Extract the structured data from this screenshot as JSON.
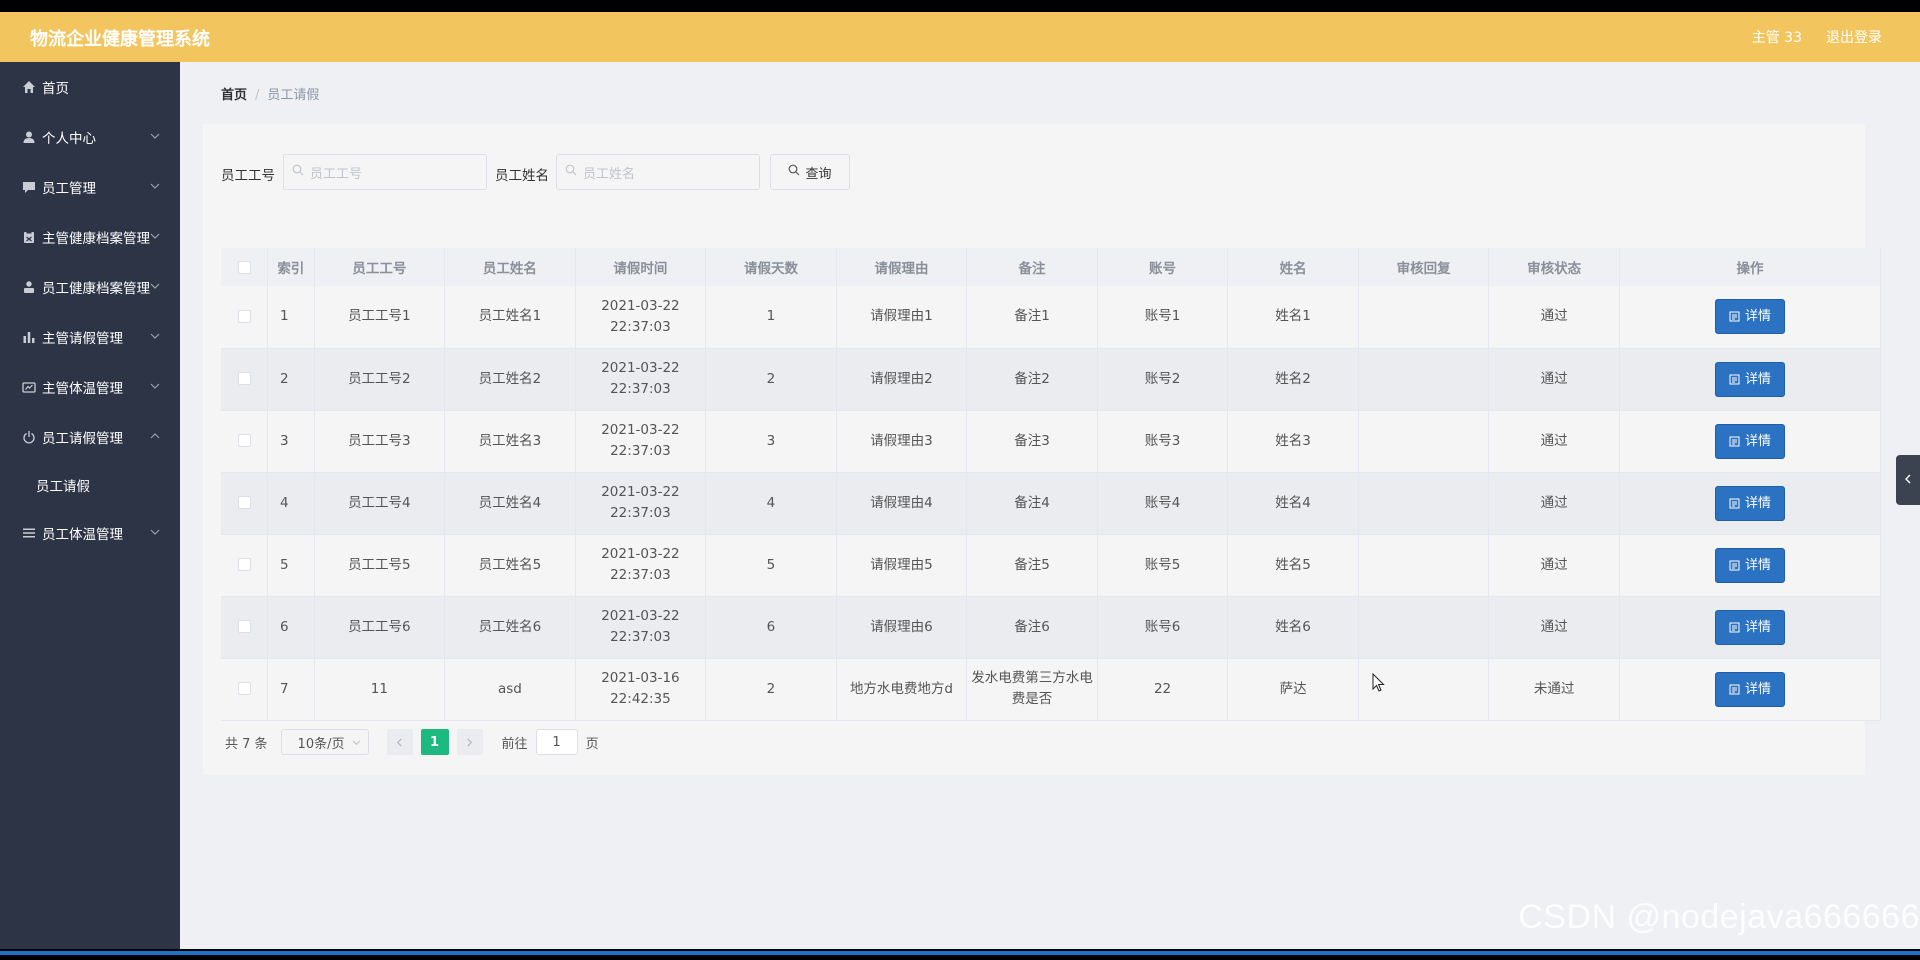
{
  "header": {
    "app_title": "物流企业健康管理系统",
    "user": "主管 33",
    "logout": "退出登录"
  },
  "sidebar": {
    "items": [
      {
        "label": "首页",
        "icon": "home-icon",
        "has_arrow": false
      },
      {
        "label": "个人中心",
        "icon": "user-icon",
        "has_arrow": true
      },
      {
        "label": "员工管理",
        "icon": "chat-icon",
        "has_arrow": true
      },
      {
        "label": "主管健康档案管理",
        "icon": "clipboard-icon",
        "has_arrow": true
      },
      {
        "label": "员工健康档案管理",
        "icon": "person-icon",
        "has_arrow": true
      },
      {
        "label": "主管请假管理",
        "icon": "bar-chart-icon",
        "has_arrow": true
      },
      {
        "label": "主管体温管理",
        "icon": "id-card-icon",
        "has_arrow": true
      },
      {
        "label": "员工请假管理",
        "icon": "power-icon",
        "has_arrow": true,
        "expanded": true,
        "children": [
          "员工请假"
        ]
      },
      {
        "label": "员工体温管理",
        "icon": "list-icon",
        "has_arrow": true
      }
    ]
  },
  "breadcrumb": {
    "home": "首页",
    "separator": "/",
    "current": "员工请假"
  },
  "search": {
    "emp_no_label": "员工工号",
    "emp_no_placeholder": "员工工号",
    "emp_name_label": "员工姓名",
    "emp_name_placeholder": "员工姓名",
    "button": "查询"
  },
  "table": {
    "headers": [
      "索引",
      "员工工号",
      "员工姓名",
      "请假时间",
      "请假天数",
      "请假理由",
      "备注",
      "账号",
      "姓名",
      "审核回复",
      "审核状态",
      "操作"
    ],
    "rows": [
      {
        "index": "1",
        "emp_no": "员工工号1",
        "emp_name": "员工姓名1",
        "time": "2021-03-22 22:37:03",
        "days": "1",
        "reason": "请假理由1",
        "note": "备注1",
        "account": "账号1",
        "name": "姓名1",
        "reply": "",
        "status": "通过",
        "action": "详情"
      },
      {
        "index": "2",
        "emp_no": "员工工号2",
        "emp_name": "员工姓名2",
        "time": "2021-03-22 22:37:03",
        "days": "2",
        "reason": "请假理由2",
        "note": "备注2",
        "account": "账号2",
        "name": "姓名2",
        "reply": "",
        "status": "通过",
        "action": "详情"
      },
      {
        "index": "3",
        "emp_no": "员工工号3",
        "emp_name": "员工姓名3",
        "time": "2021-03-22 22:37:03",
        "days": "3",
        "reason": "请假理由3",
        "note": "备注3",
        "account": "账号3",
        "name": "姓名3",
        "reply": "",
        "status": "通过",
        "action": "详情"
      },
      {
        "index": "4",
        "emp_no": "员工工号4",
        "emp_name": "员工姓名4",
        "time": "2021-03-22 22:37:03",
        "days": "4",
        "reason": "请假理由4",
        "note": "备注4",
        "account": "账号4",
        "name": "姓名4",
        "reply": "",
        "status": "通过",
        "action": "详情"
      },
      {
        "index": "5",
        "emp_no": "员工工号5",
        "emp_name": "员工姓名5",
        "time": "2021-03-22 22:37:03",
        "days": "5",
        "reason": "请假理由5",
        "note": "备注5",
        "account": "账号5",
        "name": "姓名5",
        "reply": "",
        "status": "通过",
        "action": "详情"
      },
      {
        "index": "6",
        "emp_no": "员工工号6",
        "emp_name": "员工姓名6",
        "time": "2021-03-22 22:37:03",
        "days": "6",
        "reason": "请假理由6",
        "note": "备注6",
        "account": "账号6",
        "name": "姓名6",
        "reply": "",
        "status": "通过",
        "action": "详情"
      },
      {
        "index": "7",
        "emp_no": "11",
        "emp_name": "asd",
        "time": "2021-03-16 22:42:35",
        "days": "2",
        "reason": "地方水电费地方d",
        "note": "发水电费第三方水电费是否",
        "account": "22",
        "name": "萨达",
        "reply": "",
        "status": "未通过",
        "action": "详情"
      }
    ]
  },
  "pagination": {
    "total": "共 7 条",
    "page_size": "10条/页",
    "current_page": "1",
    "goto_prefix": "前往",
    "goto_value": "1",
    "goto_suffix": "页"
  },
  "watermark": "CSDN @nodejava666666",
  "colors": {
    "header_bg": "#f3c55f",
    "sidebar_bg": "#2d3446",
    "detail_button": "#2b72c2",
    "active_page": "#1eb980"
  }
}
